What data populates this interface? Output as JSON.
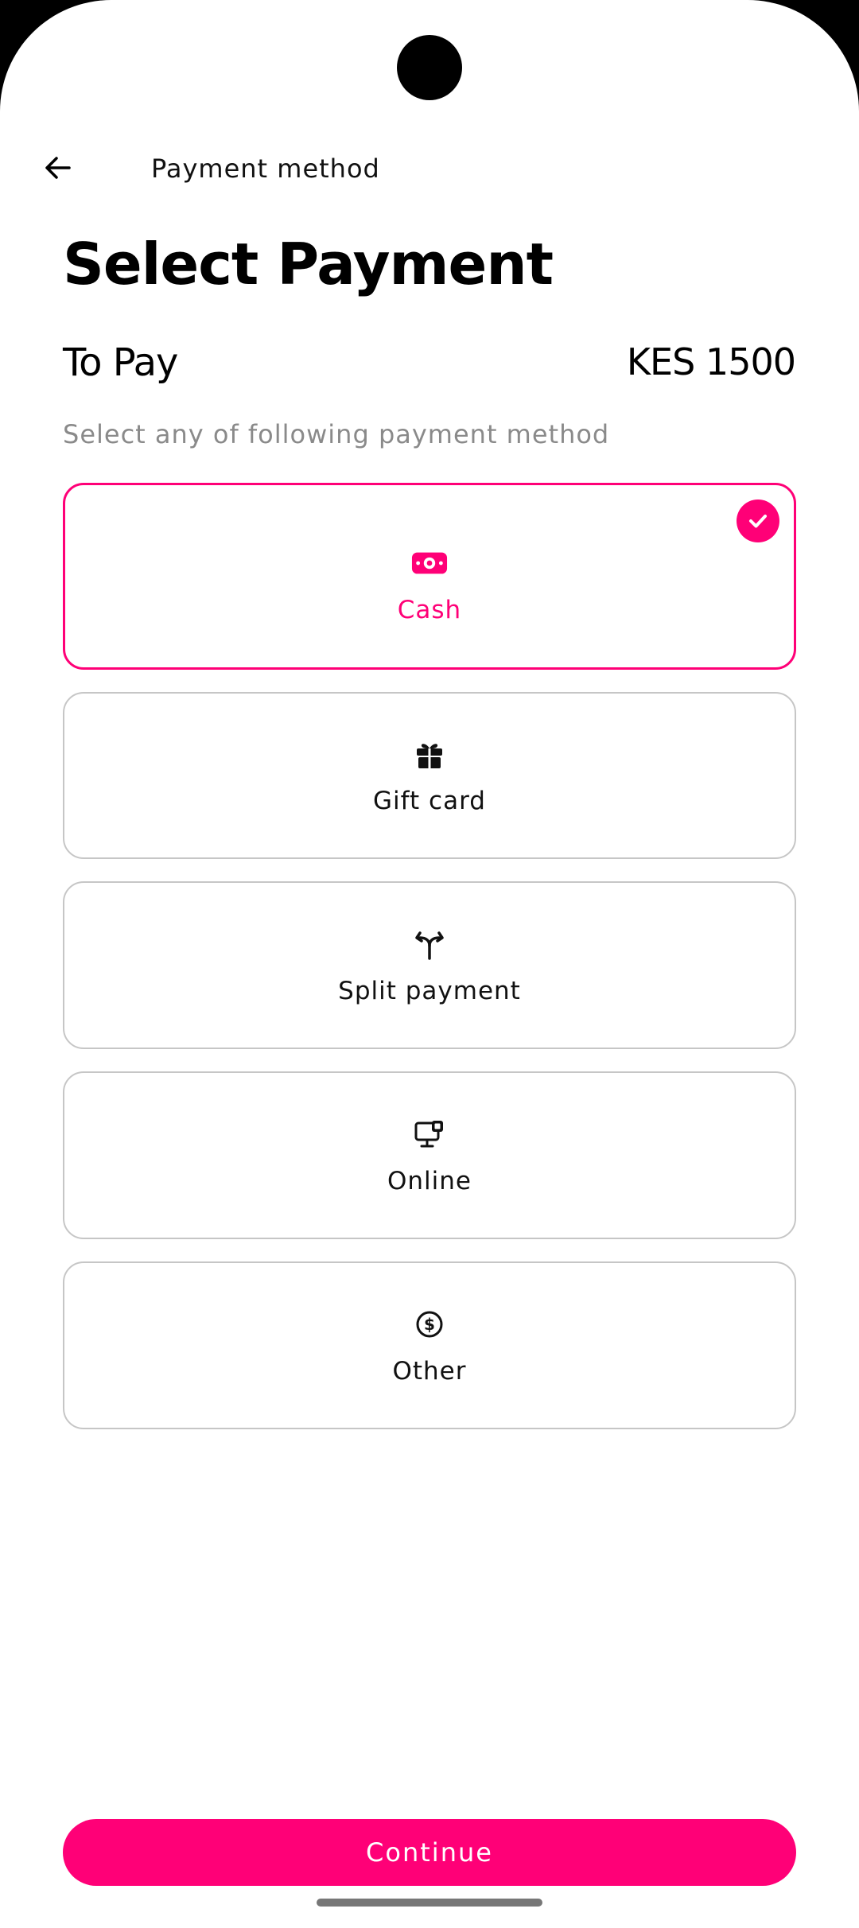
{
  "header": {
    "title": "Payment method",
    "back_icon": "arrow-left-icon"
  },
  "main": {
    "heading": "Select Payment",
    "to_pay_label": "To Pay",
    "to_pay_amount": "KES 1500",
    "hint": "Select any of following payment method",
    "options": [
      {
        "label": "Cash",
        "icon": "cash-icon",
        "selected": true
      },
      {
        "label": "Gift card",
        "icon": "gift-icon",
        "selected": false
      },
      {
        "label": "Split payment",
        "icon": "split-icon",
        "selected": false
      },
      {
        "label": "Online",
        "icon": "online-payment-icon",
        "selected": false
      },
      {
        "label": "Other",
        "icon": "dollar-circle-icon",
        "selected": false
      }
    ]
  },
  "footer": {
    "continue_label": "Continue"
  },
  "colors": {
    "accent": "#ff0077",
    "border": "#c6c6c6",
    "hint_text": "#8a8a8a"
  }
}
